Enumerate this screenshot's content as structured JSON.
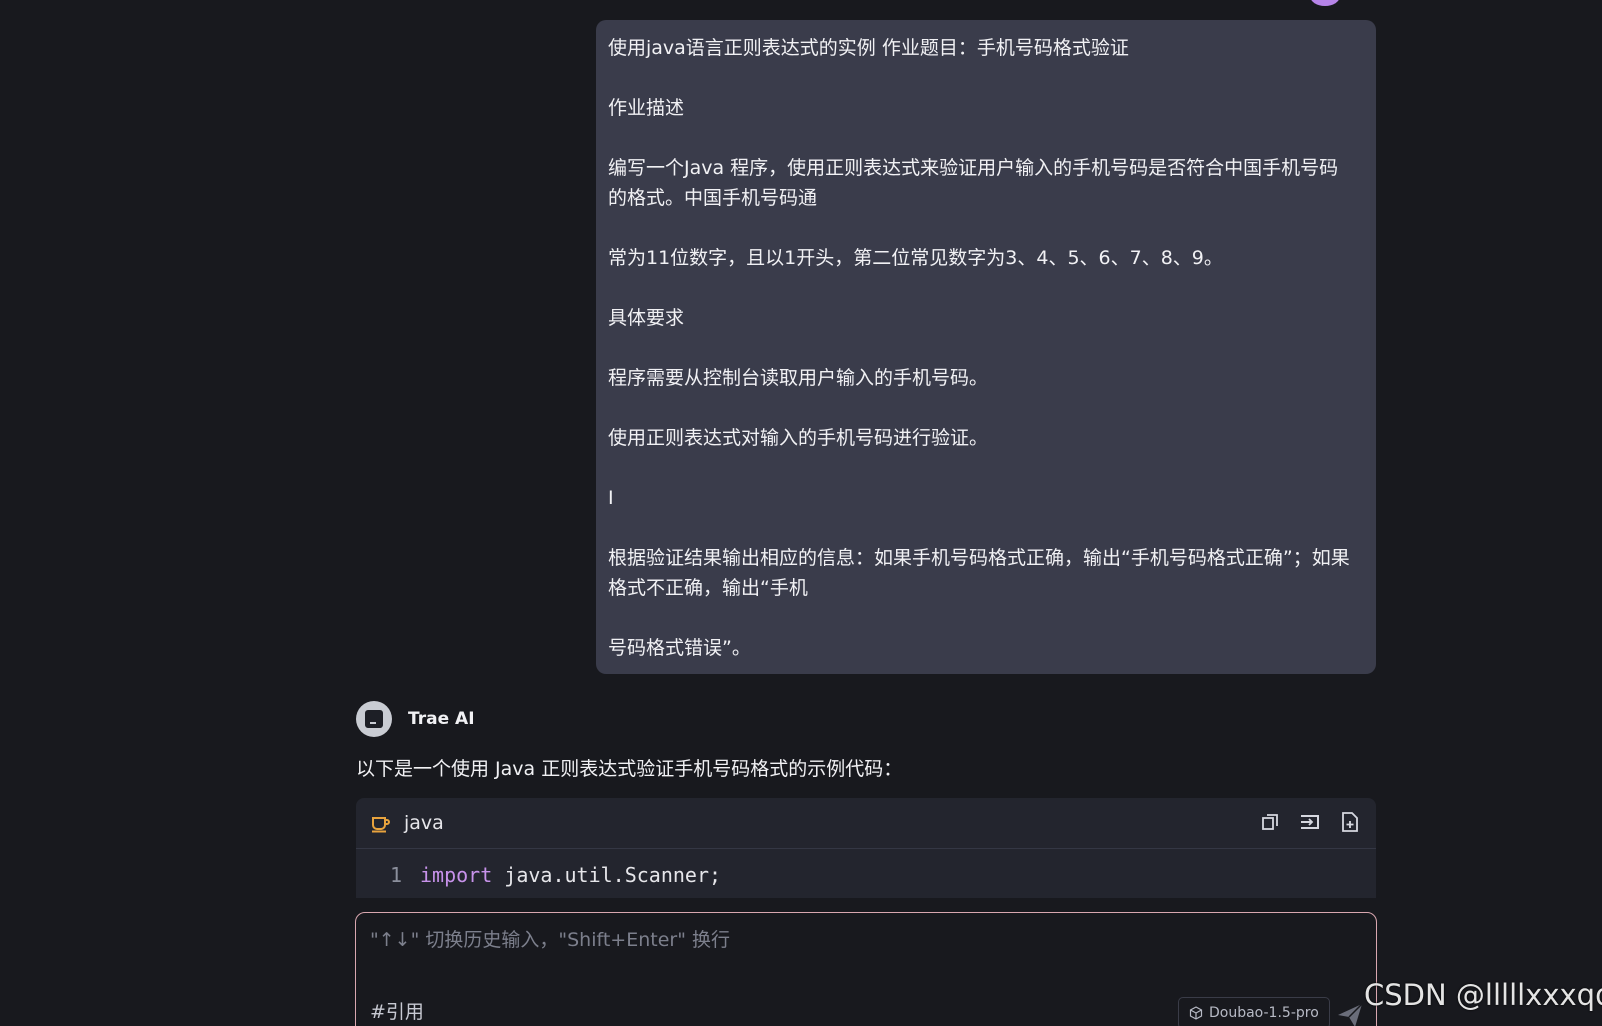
{
  "user_message": {
    "lines": [
      "使用java语言正则表达式的实例  作业题目：手机号码格式验证",
      "作业描述",
      "编写一个Java 程序，使用正则表达式来验证用户输入的手机号码是否符合中国手机号码",
      "的格式。中国手机号码通",
      "常为11位数字，且以1开头，第二位常见数字为3、4、5、6、7、8、9。",
      "具体要求",
      "程序需要从控制台读取用户输入的手机号码。",
      "使用正则表达式对输入的手机号码进行验证。",
      "I",
      "根据验证结果输出相应的信息：如果手机号码格式正确，输出“手机号码格式正确”；如果",
      "格式不正确，输出“手机",
      "号码格式错误”。"
    ]
  },
  "ai": {
    "name": "Trae AI",
    "intro": "以下是一个使用 Java 正则表达式验证手机号码格式的示例代码："
  },
  "code_block": {
    "language": "java",
    "lines": [
      {
        "number": "1",
        "keyword": "import",
        "text": " java.util.Scanner;"
      }
    ],
    "actions": [
      "copy-icon",
      "insert-icon",
      "new-file-icon"
    ]
  },
  "input": {
    "placeholder": "\"↑↓\" 切换历史输入，\"Shift+Enter\" 换行",
    "reference_label": "#引用",
    "model": "Doubao-1.5-pro"
  },
  "watermark": "CSDN @lllllxxxqq",
  "colors": {
    "background": "#18191e",
    "bubble": "#3a3c4b",
    "code_bg": "#23252e",
    "keyword": "#c792ea",
    "input_border": "#d9a7b0",
    "lang_icon": "#e8a33d"
  }
}
